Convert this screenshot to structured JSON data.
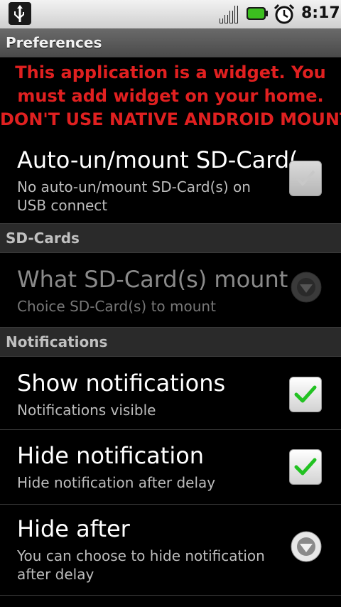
{
  "status_bar": {
    "time": "8:17",
    "icons": [
      "usb-icon",
      "signal-icon",
      "battery-icon",
      "alarm-icon"
    ],
    "battery_color": "#3cbf1f"
  },
  "app_title": "Preferences",
  "warning": {
    "line1": "This application is a widget. You",
    "line2": "must add widget on your home.",
    "line3": "DON'T USE NATIVE ANDROID MOUNT",
    "color": "#e02020"
  },
  "prefs": {
    "auto_mount": {
      "title": "Auto-un/mount SD-Card(",
      "summary": "No auto-un/mount SD-Card(s) on USB connect",
      "checked": false
    },
    "what_mount": {
      "title": "What SD-Card(s) mount",
      "summary": "Choice SD-Card(s) to mount",
      "enabled": false
    },
    "show_notifications": {
      "title": "Show notifications",
      "summary": "Notifications visible",
      "checked": true
    },
    "hide_notification": {
      "title": "Hide notification",
      "summary": "Hide notification after delay",
      "checked": true
    },
    "hide_after": {
      "title": "Hide after",
      "summary": "You can choose to hide notification after delay"
    }
  },
  "categories": {
    "sdcards": "SD-Cards",
    "notifications": "Notifications"
  },
  "colors": {
    "check_green": "#22c222"
  }
}
